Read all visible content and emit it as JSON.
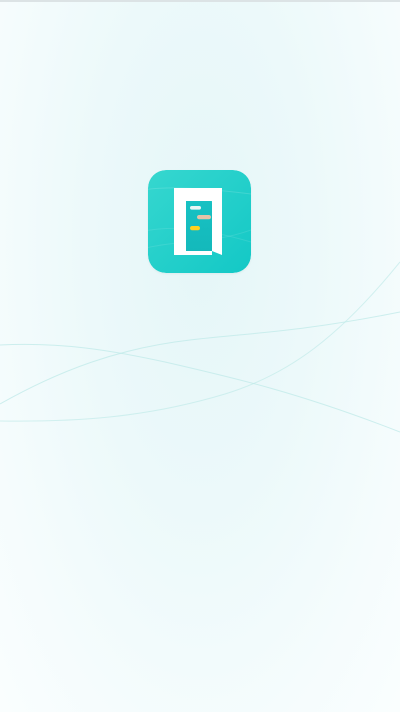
{
  "screen": {
    "type": "splash"
  },
  "logo": {
    "icon": "document-chart-icon",
    "colors": {
      "tile_light": "#34d6cf",
      "tile_dark": "#14c8c5",
      "page": "#ffffff",
      "bar_light": "#e8f6f5",
      "bar_tan": "#e5c3a8",
      "bar_yellow": "#ffd21f"
    }
  },
  "background": {
    "colors": {
      "base": "#f3fbfc",
      "wave": "#c9eeee"
    }
  }
}
